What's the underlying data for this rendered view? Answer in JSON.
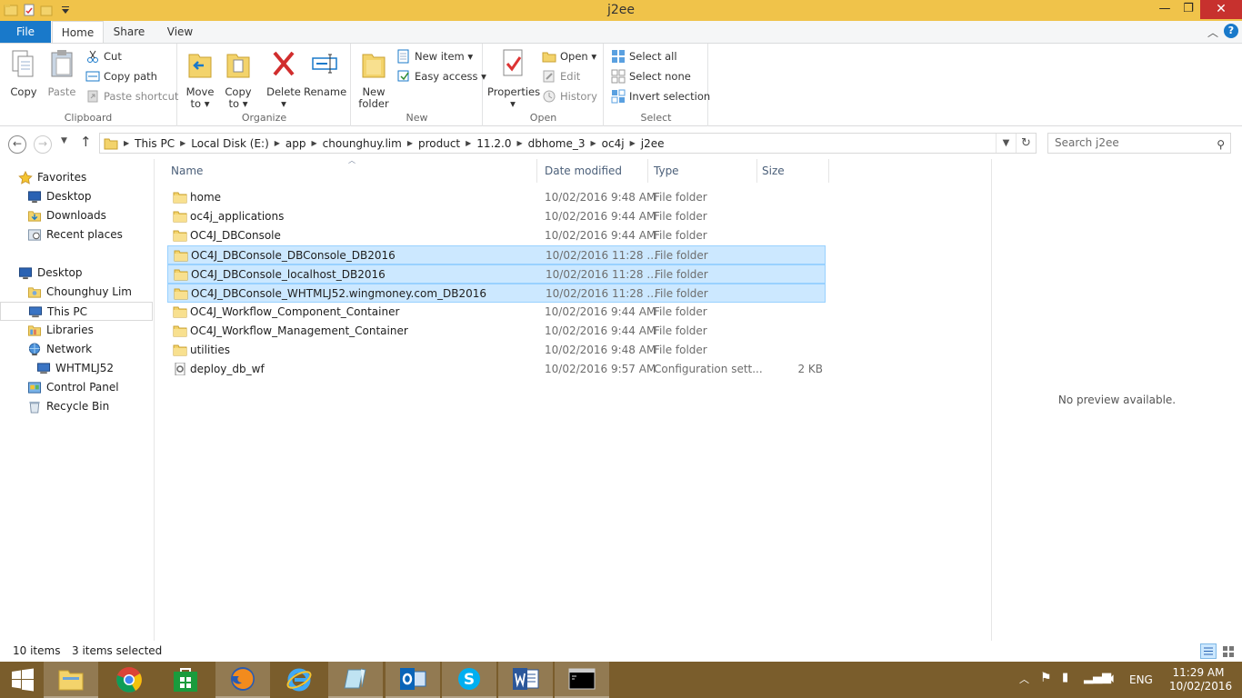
{
  "window": {
    "title": "j2ee",
    "minimize": "—",
    "maximize": "❐",
    "close": "✕"
  },
  "ribbon_tabs": [
    "File",
    "Home",
    "Share",
    "View"
  ],
  "help_label": "?",
  "ribbon": {
    "clipboard": {
      "label": "Clipboard",
      "copy": "Copy",
      "paste": "Paste",
      "cut": "Cut",
      "copy_path": "Copy path",
      "paste_shortcut": "Paste shortcut"
    },
    "organize": {
      "label": "Organize",
      "move_to": [
        "Move",
        "to ▾"
      ],
      "copy_to": [
        "Copy",
        "to ▾"
      ],
      "delete": [
        "Delete",
        "▾"
      ],
      "rename": "Rename"
    },
    "new": {
      "label": "New",
      "new_folder": [
        "New",
        "folder"
      ],
      "new_item": "New item ▾",
      "easy_access": "Easy access ▾"
    },
    "open": {
      "label": "Open",
      "properties": [
        "Properties",
        "▾"
      ],
      "open": "Open ▾",
      "edit": "Edit",
      "history": "History"
    },
    "select": {
      "label": "Select",
      "select_all": "Select all",
      "select_none": "Select none",
      "invert_selection": "Invert selection"
    }
  },
  "breadcrumb": [
    "This PC",
    "Local Disk (E:)",
    "app",
    "chounghuy.lim",
    "product",
    "11.2.0",
    "dbhome_3",
    "oc4j",
    "j2ee"
  ],
  "search": {
    "placeholder": "Search j2ee"
  },
  "nav": {
    "favorites": "Favorites",
    "desktop_fav": "Desktop",
    "downloads": "Downloads",
    "recent": "Recent places",
    "desktop": "Desktop",
    "user": "Chounghuy Lim",
    "this_pc": "This PC",
    "libraries": "Libraries",
    "network": "Network",
    "whtmlj52": "WHTMLJ52",
    "control_panel": "Control Panel",
    "recycle_bin": "Recycle Bin"
  },
  "columns": {
    "name": "Name",
    "date": "Date modified",
    "type": "Type",
    "size": "Size"
  },
  "files": [
    {
      "name": "home",
      "date": "10/02/2016 9:48 AM",
      "type": "File folder",
      "size": "",
      "selected": false,
      "kind": "folder"
    },
    {
      "name": "oc4j_applications",
      "date": "10/02/2016 9:44 AM",
      "type": "File folder",
      "size": "",
      "selected": false,
      "kind": "folder"
    },
    {
      "name": "OC4J_DBConsole",
      "date": "10/02/2016 9:44 AM",
      "type": "File folder",
      "size": "",
      "selected": false,
      "kind": "folder"
    },
    {
      "name": "OC4J_DBConsole_DBConsole_DB2016",
      "date": "10/02/2016 11:28 ...",
      "type": "File folder",
      "size": "",
      "selected": true,
      "kind": "folder"
    },
    {
      "name": "OC4J_DBConsole_localhost_DB2016",
      "date": "10/02/2016 11:28 ...",
      "type": "File folder",
      "size": "",
      "selected": true,
      "kind": "folder"
    },
    {
      "name": "OC4J_DBConsole_WHTMLJ52.wingmoney.com_DB2016",
      "date": "10/02/2016 11:28 ...",
      "type": "File folder",
      "size": "",
      "selected": true,
      "kind": "folder"
    },
    {
      "name": "OC4J_Workflow_Component_Container",
      "date": "10/02/2016 9:44 AM",
      "type": "File folder",
      "size": "",
      "selected": false,
      "kind": "folder"
    },
    {
      "name": "OC4J_Workflow_Management_Container",
      "date": "10/02/2016 9:44 AM",
      "type": "File folder",
      "size": "",
      "selected": false,
      "kind": "folder"
    },
    {
      "name": "utilities",
      "date": "10/02/2016 9:48 AM",
      "type": "File folder",
      "size": "",
      "selected": false,
      "kind": "folder"
    },
    {
      "name": "deploy_db_wf",
      "date": "10/02/2016 9:57 AM",
      "type": "Configuration sett...",
      "size": "2 KB",
      "selected": false,
      "kind": "config"
    }
  ],
  "preview": {
    "text": "No preview available."
  },
  "status": {
    "items": "10 items",
    "selected": "3 items selected"
  },
  "tray": {
    "lang": "ENG",
    "time": "11:29 AM",
    "date": "10/02/2016"
  },
  "colors": {
    "accent": "#1979ca",
    "titlebar": "#f0c34a",
    "selection": "#cce8ff",
    "taskbar": "#7a5d2c"
  }
}
